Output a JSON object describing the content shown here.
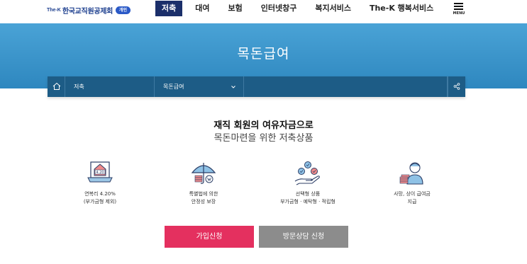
{
  "header": {
    "logo_prefix": "The-K",
    "logo_org": "한국교직원공제회",
    "logo_badge": "개인",
    "nav": [
      {
        "label": "저축",
        "active": true
      },
      {
        "label": "대여"
      },
      {
        "label": "보험"
      },
      {
        "label": "인터넷창구"
      },
      {
        "label": "복지서비스"
      },
      {
        "label": "The-K 행복서비스"
      }
    ],
    "menu_label": "MENU"
  },
  "banner": {
    "title": "목돈급여"
  },
  "breadcrumb": {
    "home_icon": "home-icon",
    "level1": "저축",
    "level2": "목돈급여",
    "share_icon": "share-icon"
  },
  "intro": {
    "headline": "재직 회원의 여유자금으로",
    "subline": "목돈마련을 위한 저축상품"
  },
  "features": [
    {
      "icon": "rate-house-icon",
      "icon_text": "4.20",
      "line1": "연복리 4.20%",
      "line2": "(부가금형 제외)"
    },
    {
      "icon": "umbrella-protection-icon",
      "line1": "특별법에 의한",
      "line2": "안정성 보장"
    },
    {
      "icon": "hand-choice-icon",
      "line1": "선택형 상품",
      "line2": "부가금형 · 예탁형 · 적립형"
    },
    {
      "icon": "person-benefit-icon",
      "line1": "사망, 상이 급여금",
      "line2": "지급"
    }
  ],
  "buttons": {
    "join": "가입신청",
    "visit": "방문상담 신청"
  },
  "colors": {
    "navy": "#1b2f6a",
    "banner": "#3a95cb",
    "breadcrumb": "#1d5c86",
    "primary_button": "#e4305f",
    "secondary_button": "#8c8c8c"
  }
}
